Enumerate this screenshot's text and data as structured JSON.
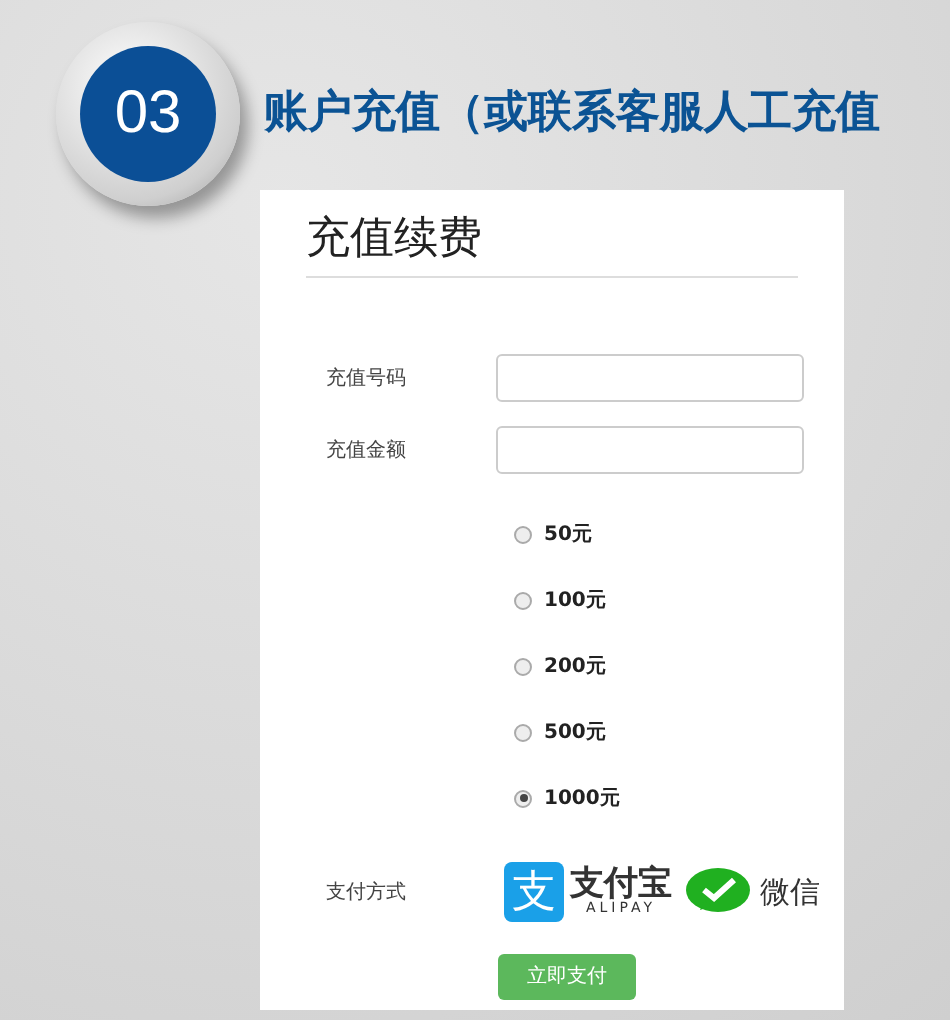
{
  "badge": {
    "number": "03"
  },
  "title": "账户充值（或联系客服人工充值",
  "form": {
    "heading": "充值续费",
    "fields": [
      {
        "label": "充值号码"
      },
      {
        "label": "充值金额"
      }
    ],
    "amounts": [
      {
        "label": "50元",
        "selected": false
      },
      {
        "label": "100元",
        "selected": false
      },
      {
        "label": "200元",
        "selected": false
      },
      {
        "label": "500元",
        "selected": false
      },
      {
        "label": "1000元",
        "selected": true
      }
    ],
    "payment": {
      "label": "支付方式",
      "alipay": {
        "glyph": "支",
        "name": "支付宝",
        "subtitle": "ALIPAY"
      },
      "wechat": {
        "name": "微信"
      }
    },
    "submit": "立即支付"
  }
}
